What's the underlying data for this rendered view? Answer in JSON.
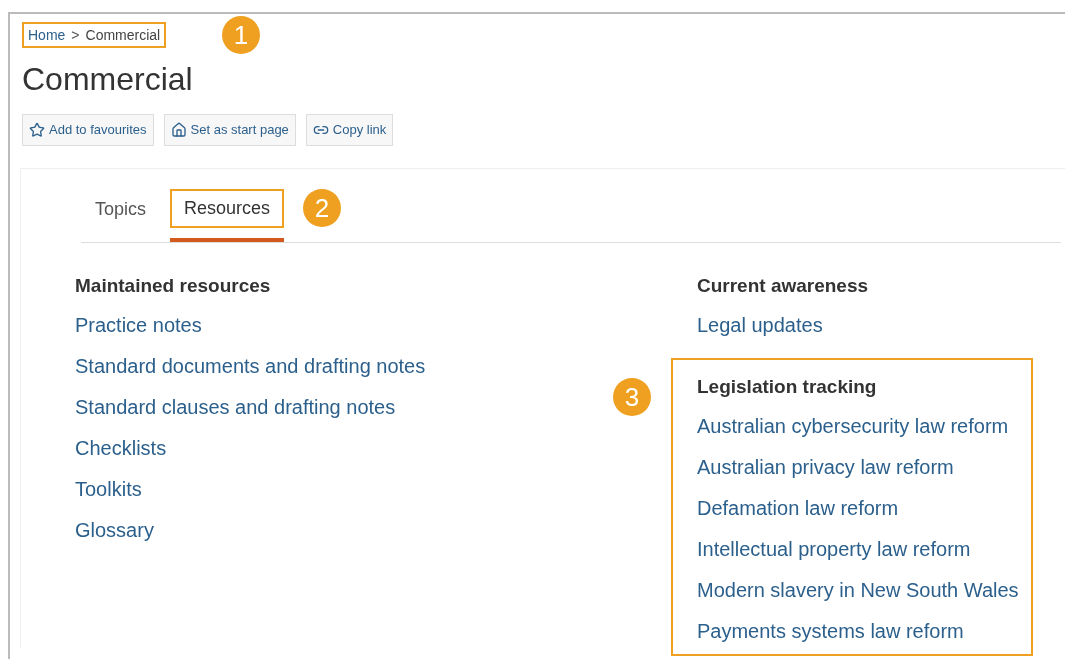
{
  "breadcrumb": {
    "items": [
      "Home",
      "Commercial"
    ],
    "separator": ">"
  },
  "title": "Commercial",
  "actions": [
    {
      "kind": "star",
      "label": "Add to favourites"
    },
    {
      "kind": "home",
      "label": "Set as start page"
    },
    {
      "kind": "link",
      "label": "Copy link"
    }
  ],
  "tabs": [
    {
      "label": "Topics",
      "selected": false
    },
    {
      "label": "Resources",
      "selected": true
    }
  ],
  "columns": [
    {
      "sections": [
        {
          "heading": "Maintained resources",
          "links": [
            "Practice notes",
            "Standard documents and drafting notes",
            "Standard clauses and drafting notes",
            "Checklists",
            "Toolkits",
            "Glossary"
          ]
        }
      ]
    },
    {
      "sections": [
        {
          "heading": "Current awareness",
          "links": [
            "Legal updates"
          ]
        },
        {
          "heading": "Legislation tracking",
          "callout": "3",
          "links": [
            "Australian cybersecurity law reform",
            "Australian privacy law reform",
            "Defamation law reform",
            "Intellectual property law reform",
            "Modern slavery in New South Wales",
            "Payments systems law reform"
          ]
        }
      ]
    }
  ],
  "callouts": {
    "breadcrumb": "1",
    "tabs": "2"
  }
}
